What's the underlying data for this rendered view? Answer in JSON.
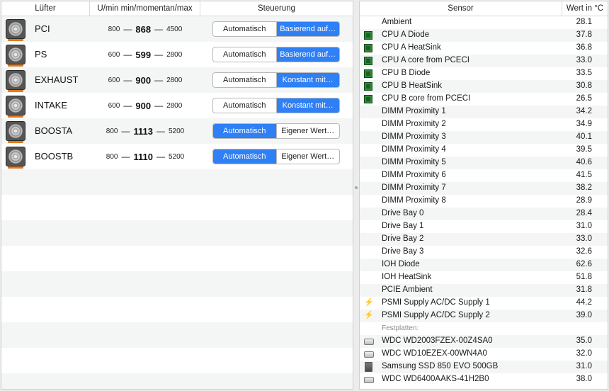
{
  "fans_table": {
    "headers": {
      "fan": "Lüfter",
      "speed": "U/min min/momentan/max",
      "control": "Steuerung"
    },
    "rows": [
      {
        "name": "PCI",
        "min": "800",
        "current": "868",
        "max": "4500",
        "auto_label": "Automatisch",
        "custom_label": "Basierend auf…",
        "selected": "custom"
      },
      {
        "name": "PS",
        "min": "600",
        "current": "599",
        "max": "2800",
        "auto_label": "Automatisch",
        "custom_label": "Basierend auf…",
        "selected": "custom"
      },
      {
        "name": "EXHAUST",
        "min": "600",
        "current": "900",
        "max": "2800",
        "auto_label": "Automatisch",
        "custom_label": "Konstant mit…",
        "selected": "custom"
      },
      {
        "name": "INTAKE",
        "min": "600",
        "current": "900",
        "max": "2800",
        "auto_label": "Automatisch",
        "custom_label": "Konstant mit…",
        "selected": "custom"
      },
      {
        "name": "BOOSTA",
        "min": "800",
        "current": "1113",
        "max": "5200",
        "auto_label": "Automatisch",
        "custom_label": "Eigener Wert…",
        "selected": "auto"
      },
      {
        "name": "BOOSTB",
        "min": "800",
        "current": "1110",
        "max": "5200",
        "auto_label": "Automatisch",
        "custom_label": "Eigener Wert…",
        "selected": "auto"
      }
    ],
    "dash": "—"
  },
  "sensors_table": {
    "headers": {
      "sensor": "Sensor",
      "value": "Wert in °C"
    },
    "rows": [
      {
        "icon": "none",
        "label": "Ambient",
        "value": "28.1"
      },
      {
        "icon": "cpu-chip-icon",
        "label": "CPU A Diode",
        "value": "37.8"
      },
      {
        "icon": "cpu-chip-icon",
        "label": "CPU A HeatSink",
        "value": "36.8"
      },
      {
        "icon": "cpu-chip-icon",
        "label": "CPU A core from PCECI",
        "value": "33.0"
      },
      {
        "icon": "cpu-chip-icon",
        "label": "CPU B Diode",
        "value": "33.5"
      },
      {
        "icon": "cpu-chip-icon",
        "label": "CPU B HeatSink",
        "value": "30.8"
      },
      {
        "icon": "cpu-chip-icon",
        "label": "CPU B core from PCECI",
        "value": "26.5"
      },
      {
        "icon": "none",
        "label": "DIMM Proximity 1",
        "value": "34.2"
      },
      {
        "icon": "none",
        "label": "DIMM Proximity 2",
        "value": "34.9"
      },
      {
        "icon": "none",
        "label": "DIMM Proximity 3",
        "value": "40.1"
      },
      {
        "icon": "none",
        "label": "DIMM Proximity 4",
        "value": "39.5"
      },
      {
        "icon": "none",
        "label": "DIMM Proximity 5",
        "value": "40.6"
      },
      {
        "icon": "none",
        "label": "DIMM Proximity 6",
        "value": "41.5"
      },
      {
        "icon": "none",
        "label": "DIMM Proximity 7",
        "value": "38.2"
      },
      {
        "icon": "none",
        "label": "DIMM Proximity 8",
        "value": "28.9"
      },
      {
        "icon": "none",
        "label": "Drive Bay 0",
        "value": "28.4"
      },
      {
        "icon": "none",
        "label": "Drive Bay 1",
        "value": "31.0"
      },
      {
        "icon": "none",
        "label": "Drive Bay 2",
        "value": "33.0"
      },
      {
        "icon": "none",
        "label": "Drive Bay 3",
        "value": "32.6"
      },
      {
        "icon": "none",
        "label": "IOH Diode",
        "value": "62.6"
      },
      {
        "icon": "none",
        "label": "IOH HeatSink",
        "value": "51.8"
      },
      {
        "icon": "none",
        "label": "PCIE Ambient",
        "value": "31.8"
      },
      {
        "icon": "lightning-bolt-icon",
        "label": "PSMI Supply AC/DC Supply 1",
        "value": "44.2"
      },
      {
        "icon": "lightning-bolt-icon",
        "label": "PSMI Supply AC/DC Supply 2",
        "value": "39.0"
      },
      {
        "icon": "section",
        "label": "Festplatten:",
        "value": ""
      },
      {
        "icon": "hard-drive-icon",
        "label": "WDC WD2003FZEX-00Z4SA0",
        "value": "35.0"
      },
      {
        "icon": "hard-drive-icon",
        "label": "WDC WD10EZEX-00WN4A0",
        "value": "32.0"
      },
      {
        "icon": "ssd-icon",
        "label": "Samsung SSD 850 EVO 500GB",
        "value": "31.0"
      },
      {
        "icon": "hard-drive-icon",
        "label": "WDC WD6400AAKS-41H2B0",
        "value": "38.0"
      }
    ]
  },
  "colors": {
    "accent": "#2f7ff5",
    "chip": "#2e8a38",
    "bolt": "#e0b020",
    "fan_stripe": "#e07a1f"
  }
}
